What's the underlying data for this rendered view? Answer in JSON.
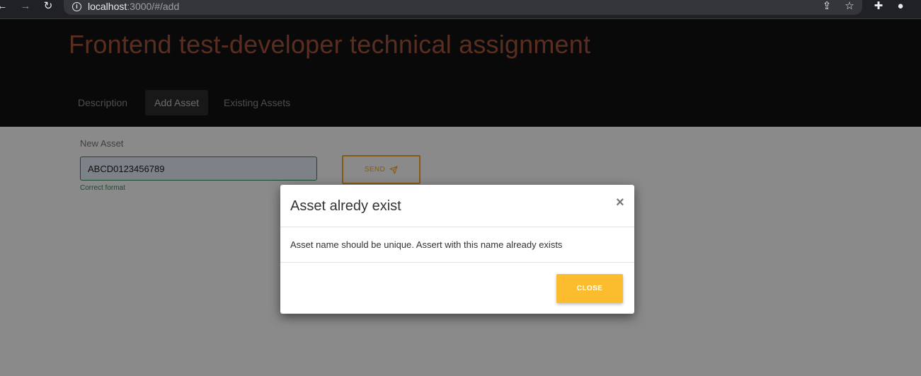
{
  "browser": {
    "url_host": "localhost",
    "url_rest": ":3000/#/add",
    "icons": [
      "back-icon",
      "forward-icon",
      "reload-icon",
      "info-icon",
      "share-icon",
      "star-icon",
      "extensions-icon",
      "profile-icon"
    ]
  },
  "header": {
    "title": "Frontend test-developer technical assignment",
    "tabs": [
      {
        "label": "Description",
        "active": false
      },
      {
        "label": "Add Asset",
        "active": true
      },
      {
        "label": "Existing Assets",
        "active": false
      }
    ]
  },
  "form": {
    "label": "New Asset",
    "input_value": "ABCD0123456789",
    "helper_text": "Correct format",
    "send_label": "SEND"
  },
  "modal": {
    "title": "Asset alredy exist",
    "close_symbol": "×",
    "message": "Asset name should be unique. Assert with this name already exists",
    "close_label": "CLOSE"
  },
  "colors": {
    "title": "#a5553d",
    "accent": "#f5a623",
    "success": "#2e8b57",
    "close_button": "#fbbd2e"
  }
}
